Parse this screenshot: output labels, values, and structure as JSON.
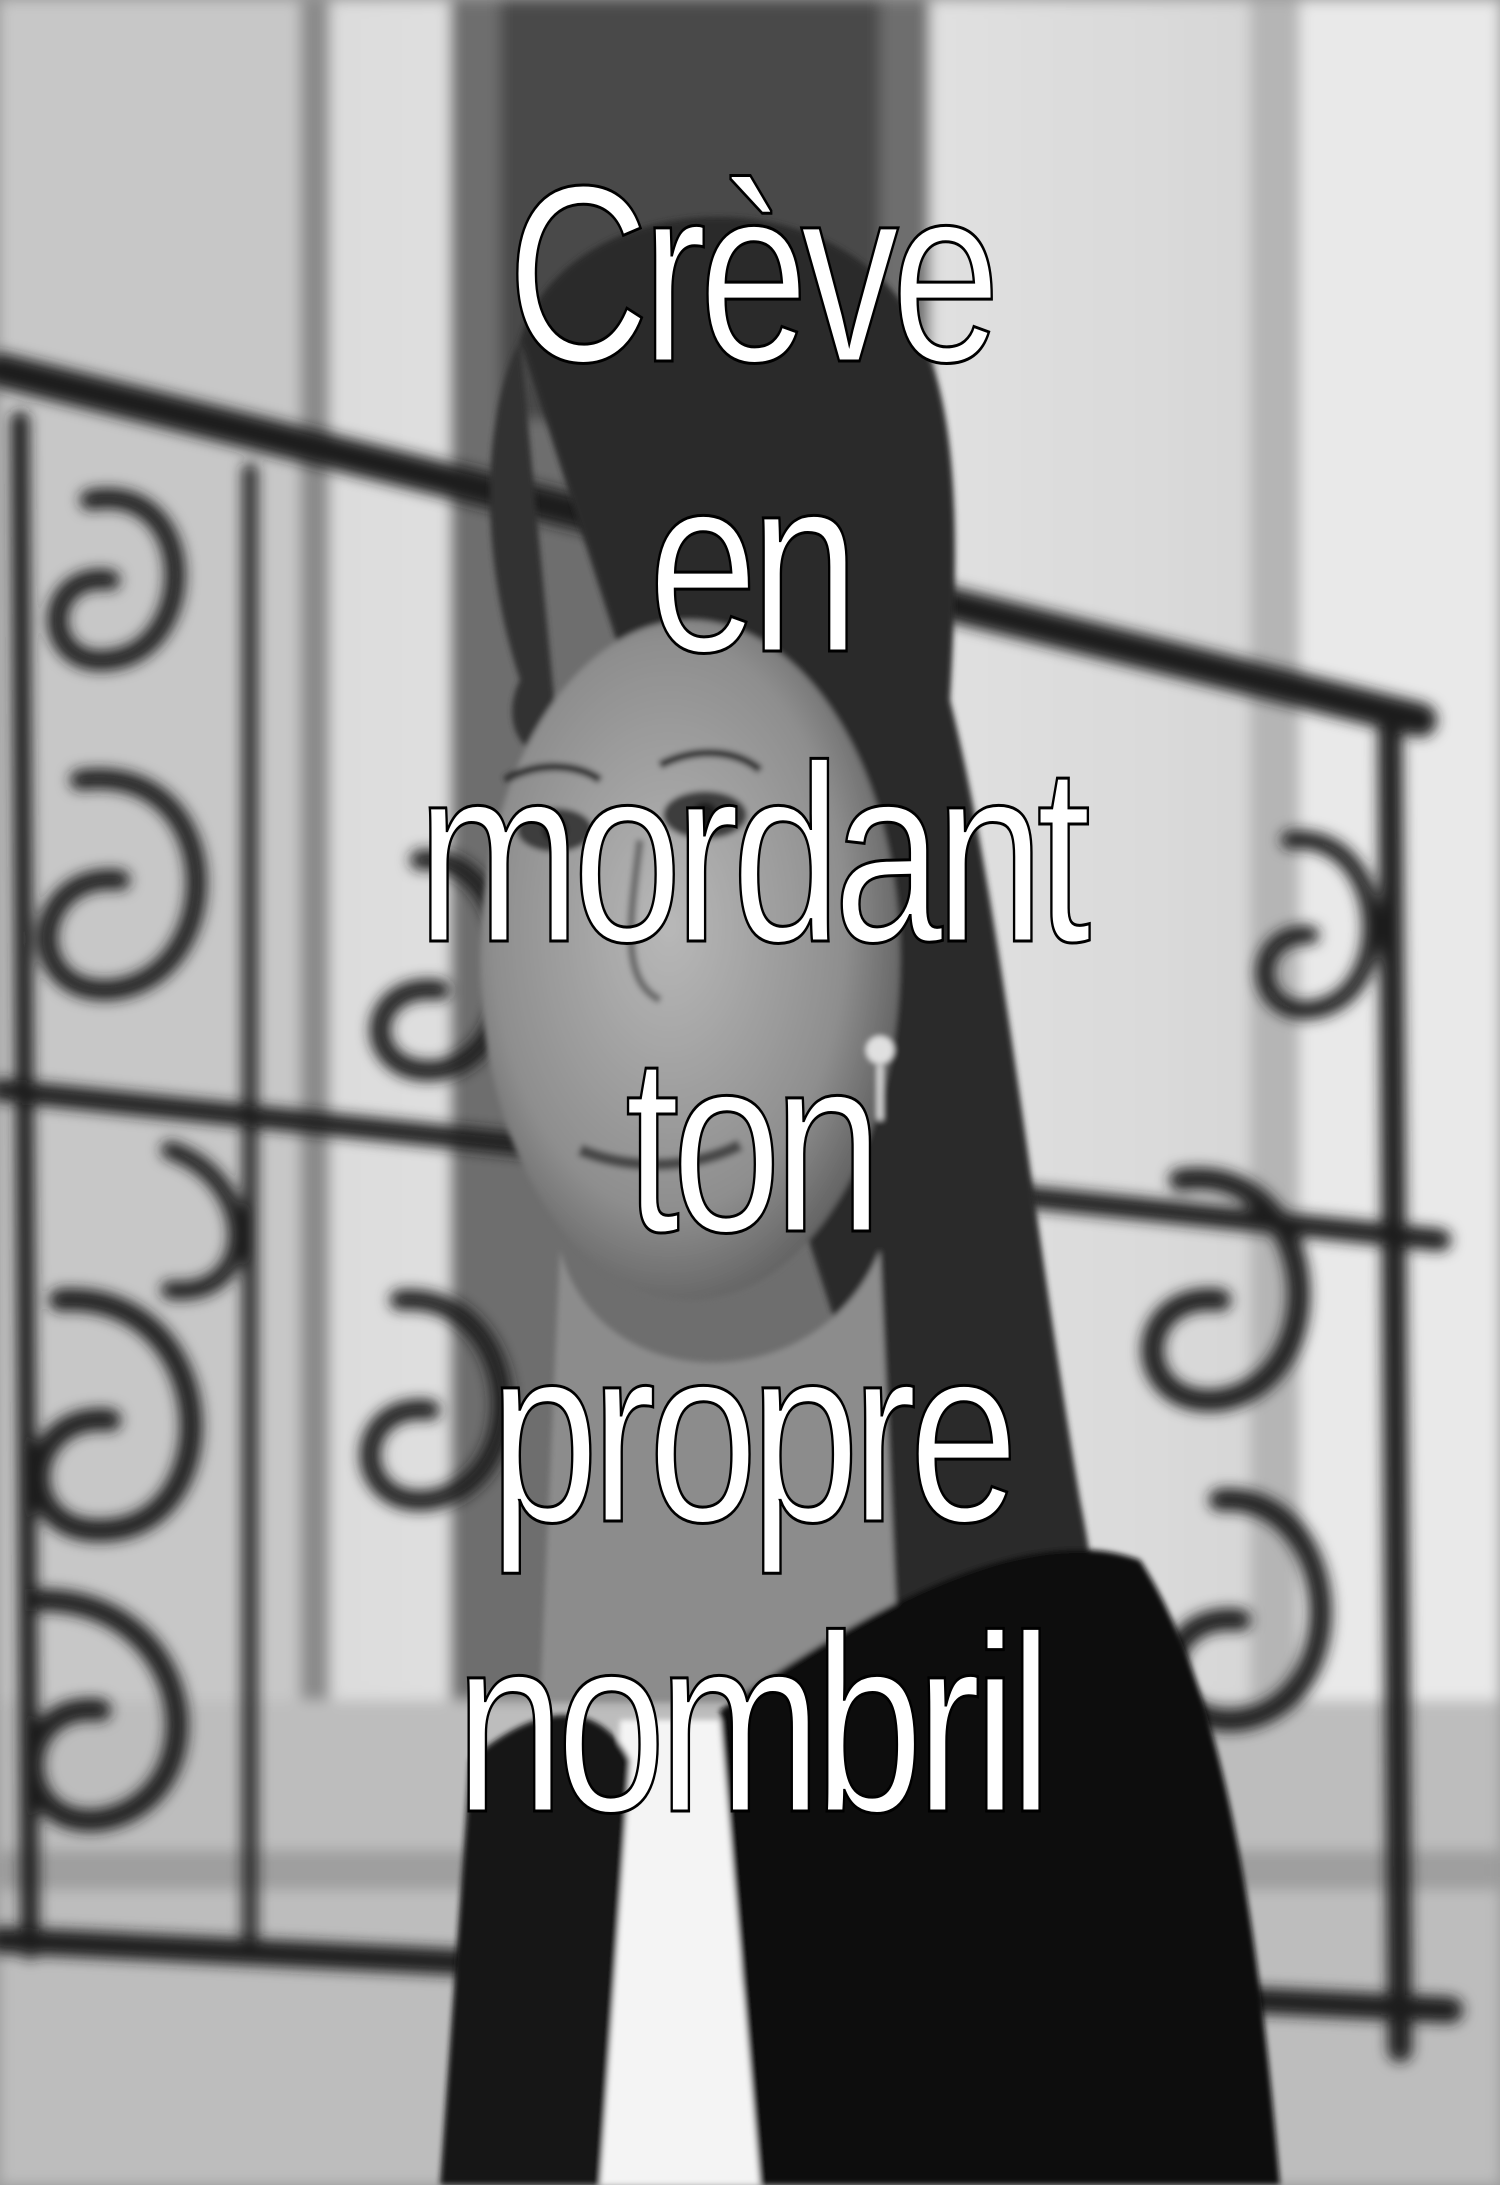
{
  "caption": {
    "lines": [
      "Crève",
      "en",
      "mordant",
      "ton",
      "propre",
      "nombril"
    ],
    "text_color": "#ffffff",
    "outline_color": "#000000"
  },
  "photo": {
    "subject": "black-and-white portrait of a woman in front of a wrought-iron balcony",
    "palette": [
      "#f2f2f2",
      "#9a9a9a",
      "#1a1a1a"
    ]
  }
}
